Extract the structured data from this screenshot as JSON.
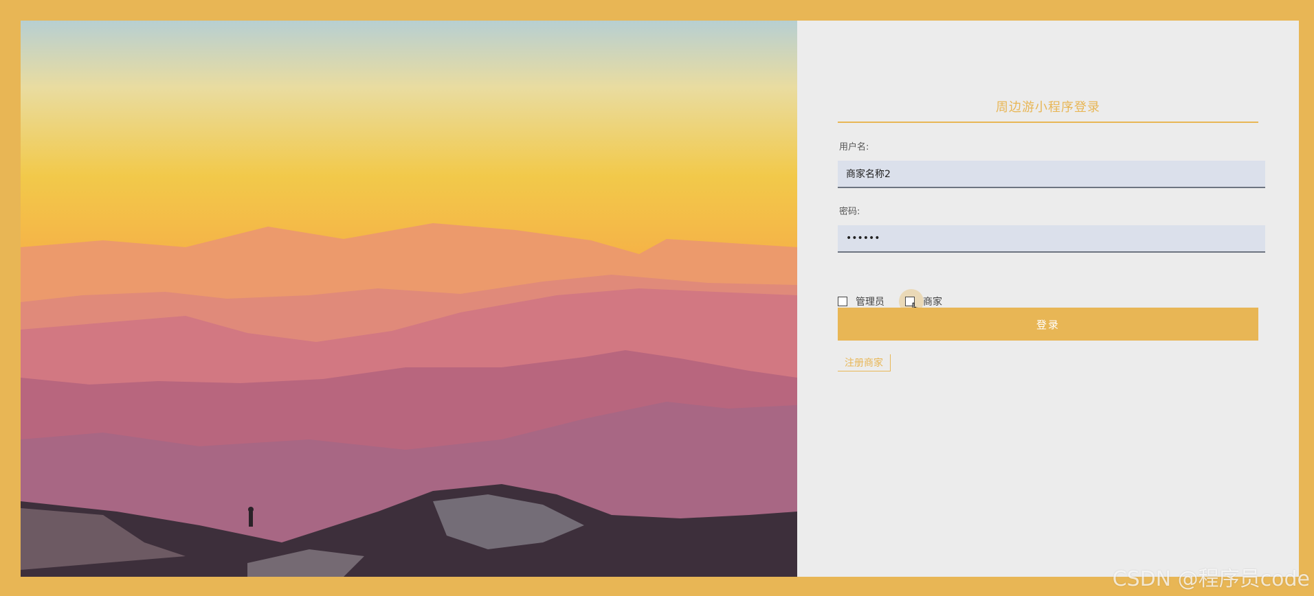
{
  "login": {
    "title": "周边游小程序登录",
    "username_label": "用户名:",
    "username_value": "商家名称2",
    "password_label": "密码:",
    "password_value": "••••••",
    "roles": [
      {
        "label": "管理员",
        "checked": false
      },
      {
        "label": "商家",
        "checked": false
      }
    ],
    "submit_label": "登录",
    "register_label": "注册商家"
  },
  "watermark": "CSDN @程序员code",
  "colors": {
    "accent": "#e8b655",
    "panel_bg": "#ececec",
    "input_bg": "#dbe0eb"
  },
  "icons": {
    "pointer": "hand-pointer-icon"
  }
}
